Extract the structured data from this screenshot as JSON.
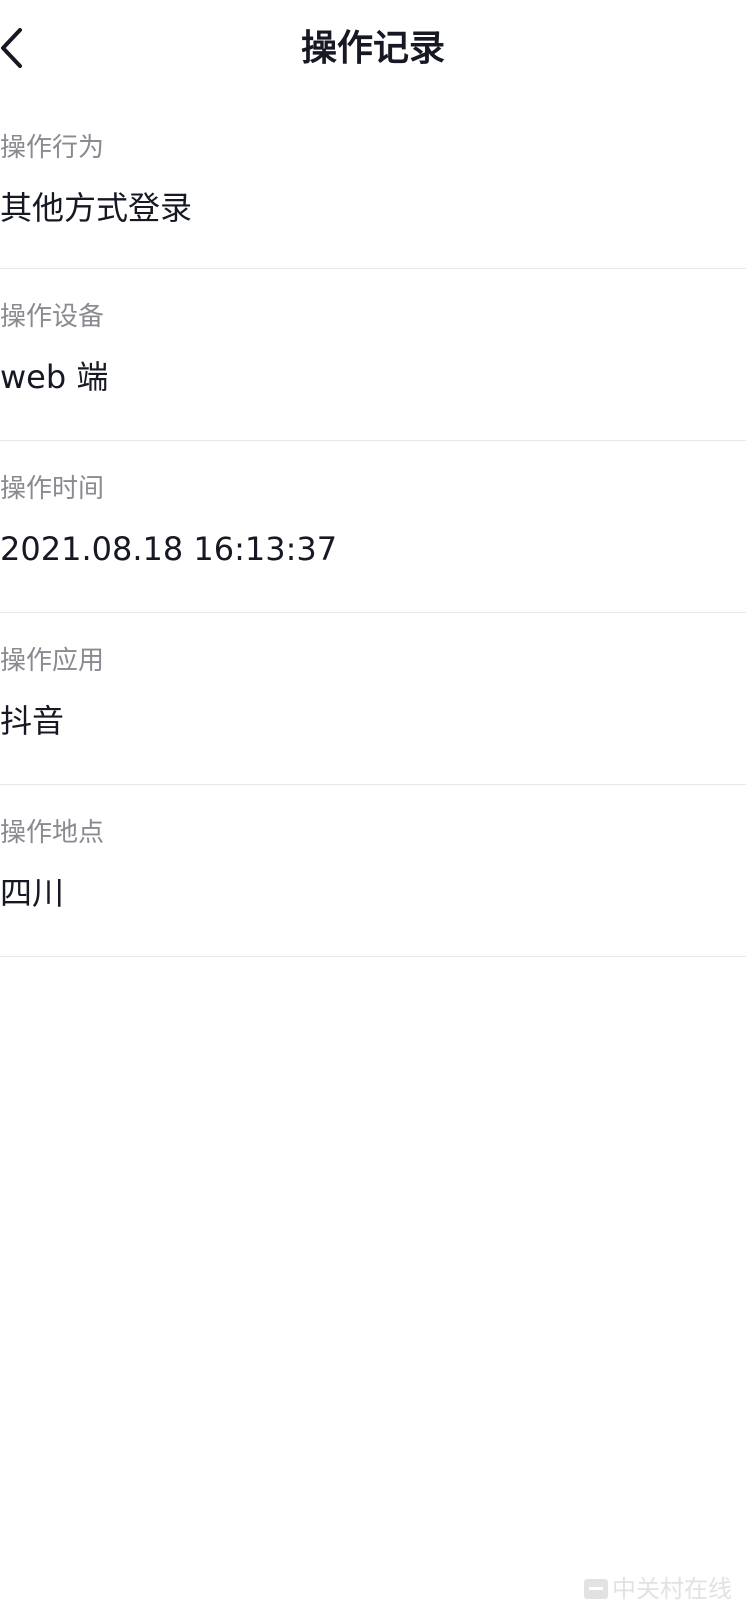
{
  "header": {
    "title": "操作记录",
    "back_icon": "chevron-left-icon"
  },
  "records": [
    {
      "label": "操作行为",
      "value": "其他方式登录"
    },
    {
      "label": "操作设备",
      "value": "web 端"
    },
    {
      "label": "操作时间",
      "value": "2021.08.18 16:13:37"
    },
    {
      "label": "操作应用",
      "value": "抖音"
    },
    {
      "label": "操作地点",
      "value": "四川"
    }
  ],
  "watermark": {
    "text": "中关村在线"
  },
  "colors": {
    "primary_text": "#161823",
    "secondary_text": "#8a8b91",
    "divider": "#e8e8ea",
    "background": "#ffffff"
  }
}
